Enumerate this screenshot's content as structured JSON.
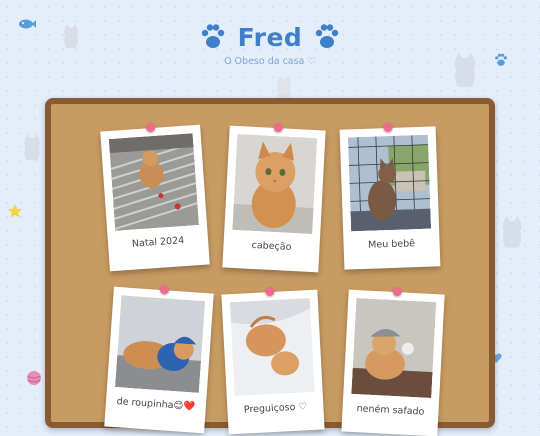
{
  "header": {
    "title": "Fred",
    "subtitle": "O Obeso da casa ♡"
  },
  "photos": [
    {
      "caption": "Natal 2024"
    },
    {
      "caption": "cabeção"
    },
    {
      "caption": "Meu bebê"
    },
    {
      "caption": "de roupinha😊❤️"
    },
    {
      "caption": "Preguiçoso ♡"
    },
    {
      "caption": "neném safado"
    }
  ],
  "colors": {
    "accent": "#3f7fc9",
    "board": "#c89b62",
    "board_frame": "#8a5a32",
    "pin": "#f06b8b",
    "background": "#e4eefb"
  }
}
